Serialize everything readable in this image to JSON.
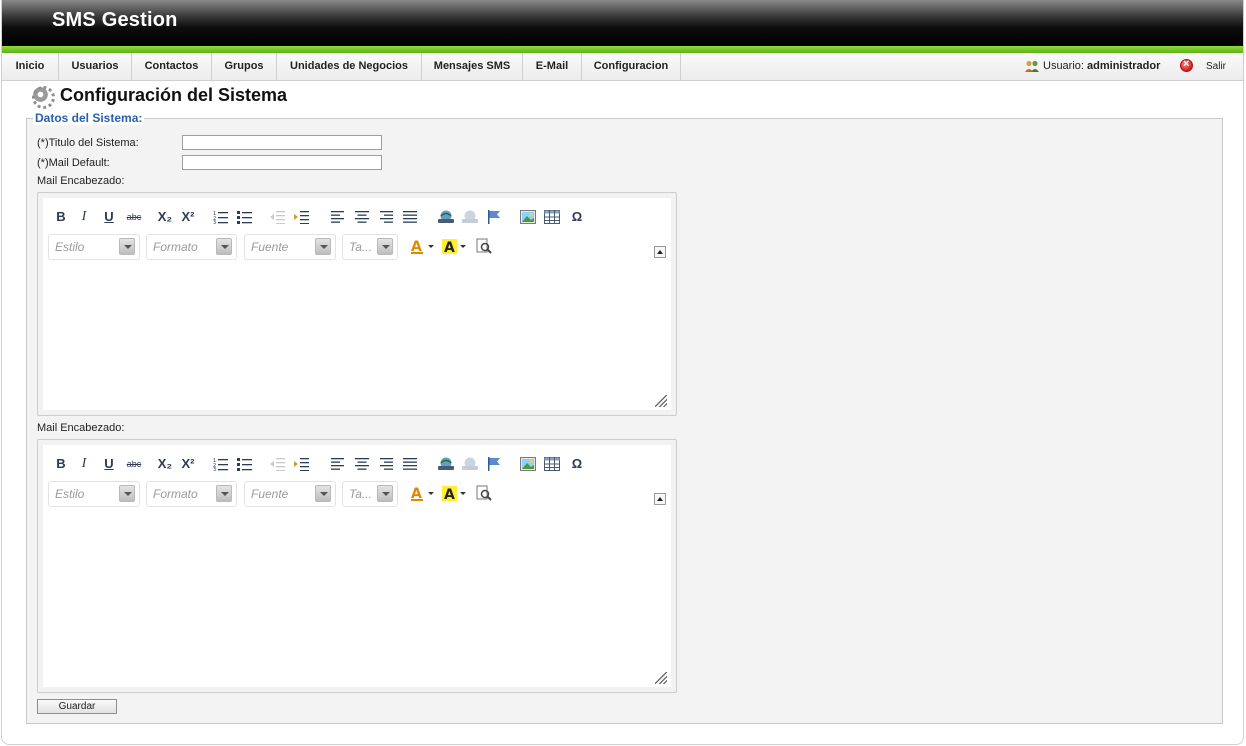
{
  "header": {
    "app_title": "SMS Gestion"
  },
  "nav": {
    "items": [
      {
        "label": "Inicio"
      },
      {
        "label": "Usuarios"
      },
      {
        "label": "Contactos"
      },
      {
        "label": "Grupos"
      },
      {
        "label": "Unidades de Negocios"
      },
      {
        "label": "Mensajes SMS"
      },
      {
        "label": "E-Mail"
      },
      {
        "label": "Configuracion"
      }
    ],
    "user_prefix": "Usuario:",
    "user_name": "administrador",
    "logout_label": "Salir"
  },
  "page": {
    "title": "Configuración del Sistema"
  },
  "form": {
    "legend": "Datos del Sistema:",
    "titulo_label": "(*)Titulo del Sistema:",
    "titulo_value": "",
    "mail_default_label": "(*)Mail Default:",
    "mail_default_value": "",
    "editor1_label": "Mail Encabezado:",
    "editor2_label": "Mail Encabezado:",
    "save_label": "Guardar"
  },
  "editor_toolbar": {
    "bold": "B",
    "italic": "I",
    "underline": "U",
    "strike": "abc",
    "subscript": "X₂",
    "superscript": "X²",
    "style_placeholder": "Estilo",
    "format_placeholder": "Formato",
    "font_placeholder": "Fuente",
    "size_placeholder": "Ta..."
  },
  "colors": {
    "accent_green": "#6cc020",
    "legend_blue": "#2a5fb0",
    "header_black": "#000000"
  }
}
